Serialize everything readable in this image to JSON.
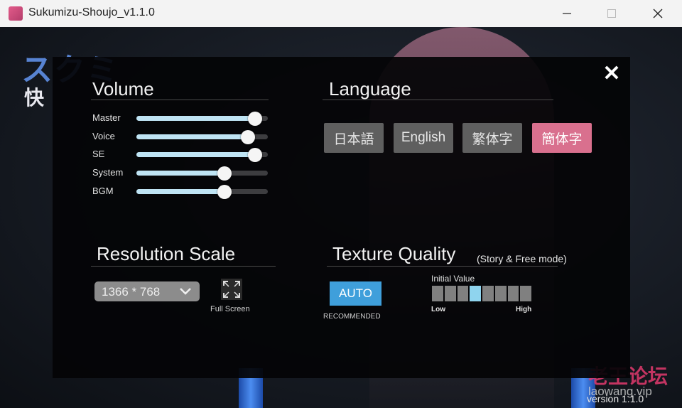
{
  "window": {
    "title": "Sukumizu-Shoujo_v1.1.0",
    "minimize_icon": "minimize-icon",
    "maximize_icon": "maximize-icon",
    "close_icon": "close-icon"
  },
  "background": {
    "watermark": "老王论坛",
    "watermark_url": "laowang.vip",
    "version": "version 1.1.0"
  },
  "settings": {
    "close_label": "✕",
    "volume": {
      "heading": "Volume",
      "sliders": [
        {
          "label": "Master",
          "value": 0.9
        },
        {
          "label": "Voice",
          "value": 0.85
        },
        {
          "label": "SE",
          "value": 0.9
        },
        {
          "label": "System",
          "value": 0.67
        },
        {
          "label": "BGM",
          "value": 0.67
        }
      ]
    },
    "language": {
      "heading": "Language",
      "options": [
        "日本語",
        "English",
        "繁体字",
        "簡体字"
      ],
      "selected": "簡体字"
    },
    "resolution": {
      "heading": "Resolution Scale",
      "selected": "1366 * 768",
      "fullscreen_label": "Full Screen"
    },
    "texture": {
      "heading": "Texture Quality",
      "subheading": "(Story & Free mode)",
      "auto_label": "AUTO",
      "recommended_label": "RECOMMENDED",
      "initial_value_label": "Initial Value",
      "levels": 8,
      "selected_level": 4,
      "low_label": "Low",
      "high_label": "High"
    }
  },
  "colors": {
    "accent_pink": "#d9708e",
    "accent_blue": "#3f9fdb",
    "slider_fill": "#bfe4f4"
  }
}
